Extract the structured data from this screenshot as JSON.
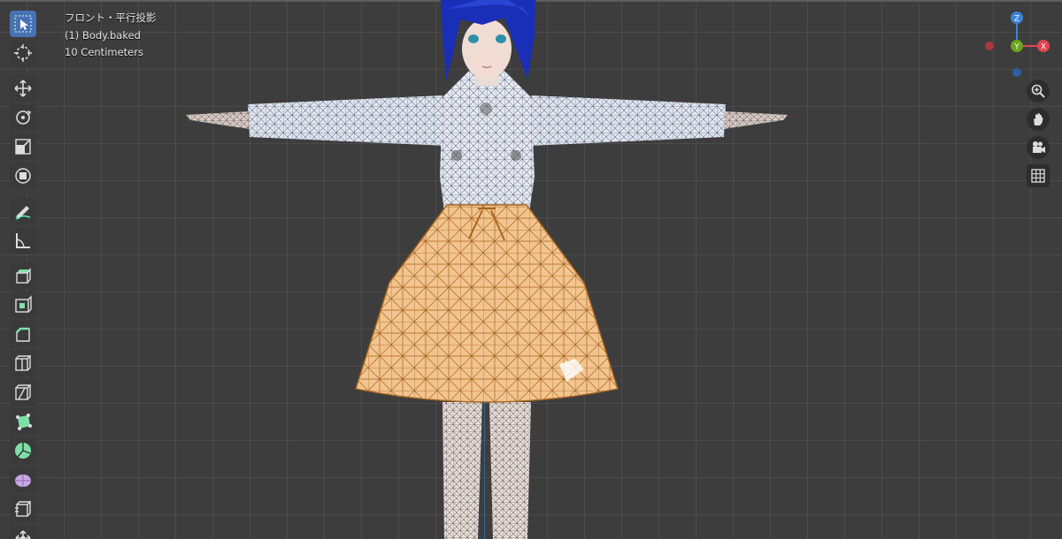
{
  "viewport": {
    "view_name": "フロント・平行投影",
    "object_name": "(1) Body.baked",
    "scale_text": "10 Centimeters"
  },
  "gizmo": {
    "z_label": "Z",
    "y_label": "Y",
    "x_label": "X",
    "colors": {
      "x": "#e0454f",
      "y": "#6aa41f",
      "z": "#3d82d8"
    }
  },
  "toolbar": {
    "tools": [
      {
        "name": "select-box-icon",
        "active": true
      },
      {
        "name": "cursor-icon"
      },
      {
        "name": "move-icon"
      },
      {
        "name": "rotate-icon"
      },
      {
        "name": "scale-icon"
      },
      {
        "name": "transform-icon"
      },
      {
        "name": "annotate-icon"
      },
      {
        "name": "measure-icon"
      },
      {
        "name": "extrude-region-icon"
      },
      {
        "name": "inset-faces-icon"
      },
      {
        "name": "bevel-icon"
      },
      {
        "name": "loop-cut-icon"
      },
      {
        "name": "knife-icon"
      },
      {
        "name": "poly-build-icon"
      },
      {
        "name": "spin-icon"
      },
      {
        "name": "smooth-icon"
      },
      {
        "name": "edge-slide-icon"
      },
      {
        "name": "shrink-fatten-icon"
      }
    ]
  },
  "navigation": [
    "zoom-icon",
    "pan-hand-icon",
    "camera-icon",
    "grid-icon"
  ],
  "colors": {
    "accent": "#4772b3",
    "skirt": "#f2c48f",
    "hair": "#1a2fb8"
  }
}
